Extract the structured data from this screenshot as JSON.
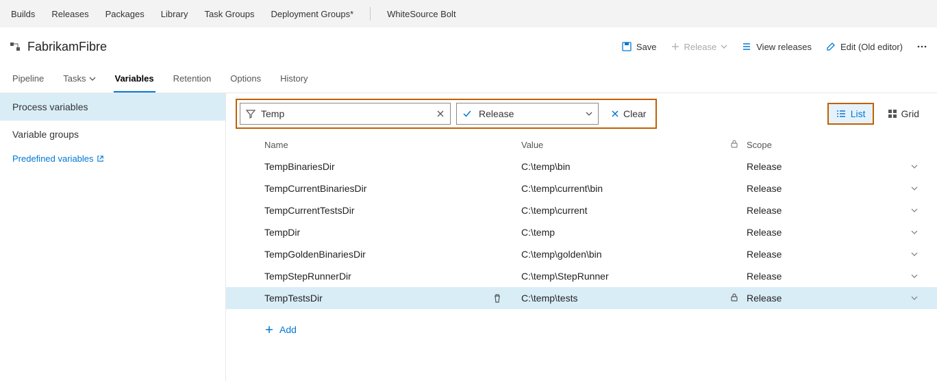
{
  "top_nav": [
    "Builds",
    "Releases",
    "Packages",
    "Library",
    "Task Groups",
    "Deployment Groups*"
  ],
  "top_nav_ext": [
    "WhiteSource Bolt"
  ],
  "pipeline_title": "FabrikamFibre",
  "header_actions": {
    "save": "Save",
    "release": "Release",
    "view_releases": "View releases",
    "edit_old": "Edit (Old editor)"
  },
  "sub_tabs": {
    "pipeline": "Pipeline",
    "tasks": "Tasks",
    "variables": "Variables",
    "retention": "Retention",
    "options": "Options",
    "history": "History"
  },
  "sidebar": {
    "process_vars": "Process variables",
    "variable_groups": "Variable groups",
    "predefined_link": "Predefined variables"
  },
  "filter": {
    "value": "Temp",
    "scope": "Release",
    "clear": "Clear"
  },
  "view": {
    "list": "List",
    "grid": "Grid"
  },
  "columns": {
    "name": "Name",
    "value": "Value",
    "scope": "Scope"
  },
  "rows": [
    {
      "name": "TempBinariesDir",
      "value": "C:\\temp\\bin",
      "scope": "Release",
      "locked": false,
      "selected": false
    },
    {
      "name": "TempCurrentBinariesDir",
      "value": "C:\\temp\\current\\bin",
      "scope": "Release",
      "locked": false,
      "selected": false
    },
    {
      "name": "TempCurrentTestsDir",
      "value": "C:\\temp\\current",
      "scope": "Release",
      "locked": false,
      "selected": false
    },
    {
      "name": "TempDir",
      "value": "C:\\temp",
      "scope": "Release",
      "locked": false,
      "selected": false
    },
    {
      "name": "TempGoldenBinariesDir",
      "value": "C:\\temp\\golden\\bin",
      "scope": "Release",
      "locked": false,
      "selected": false
    },
    {
      "name": "TempStepRunnerDir",
      "value": "C:\\temp\\StepRunner",
      "scope": "Release",
      "locked": false,
      "selected": false
    },
    {
      "name": "TempTestsDir",
      "value": "C:\\temp\\tests",
      "scope": "Release",
      "locked": true,
      "selected": true
    }
  ],
  "add_label": "Add"
}
